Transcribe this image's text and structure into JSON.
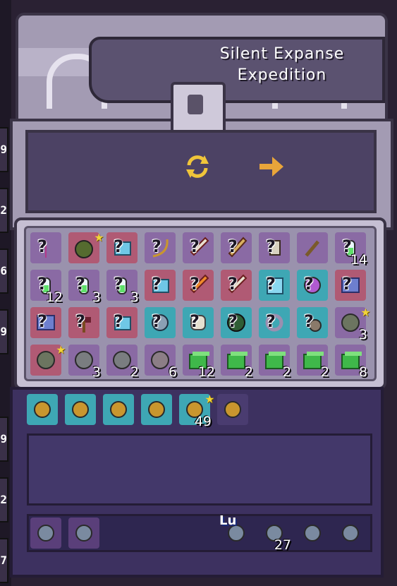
{
  "window_title": "Silent Expanse Expedition",
  "controls": {
    "refresh_icon": "refresh-icon",
    "arrow_icon": "right-arrow-icon",
    "accent": "#e9a53a"
  },
  "edge_numbers": [
    "9",
    "2",
    "6",
    "9",
    "9",
    "2",
    "7"
  ],
  "inventory": {
    "rows": [
      [
        {
          "item": "trident",
          "bg": "#8a6aa4",
          "count": "",
          "star": false,
          "unknown": true
        },
        {
          "item": "moss-bundle",
          "bg": "#b05a74",
          "count": "",
          "star": true,
          "unknown": false
        },
        {
          "item": "ice-rune",
          "bg": "#b05a74",
          "count": "",
          "star": false,
          "unknown": true
        },
        {
          "item": "bow",
          "bg": "#8a6aa4",
          "count": "",
          "star": false,
          "unknown": true
        },
        {
          "item": "blade",
          "bg": "#8a6aa4",
          "count": "",
          "star": false,
          "unknown": true
        },
        {
          "item": "spear",
          "bg": "#8a6aa4",
          "count": "",
          "star": false,
          "unknown": true
        },
        {
          "item": "claw",
          "bg": "#8a6aa4",
          "count": "",
          "star": false,
          "unknown": true
        },
        {
          "item": "staff",
          "bg": "#8a6aa4",
          "count": "",
          "star": false,
          "unknown": false
        },
        {
          "item": "potion",
          "bg": "#8a6aa4",
          "count": "14",
          "star": false,
          "unknown": true
        }
      ],
      [
        {
          "item": "potion",
          "bg": "#8a6aa4",
          "count": "12",
          "star": false,
          "unknown": true
        },
        {
          "item": "potion",
          "bg": "#8a6aa4",
          "count": "3",
          "star": false,
          "unknown": true
        },
        {
          "item": "potion",
          "bg": "#8a6aa4",
          "count": "3",
          "star": false,
          "unknown": true
        },
        {
          "item": "ice-rune",
          "bg": "#b05a74",
          "count": "",
          "star": false,
          "unknown": true
        },
        {
          "item": "flame-blade",
          "bg": "#b05a74",
          "count": "",
          "star": false,
          "unknown": true
        },
        {
          "item": "blade",
          "bg": "#b05a74",
          "count": "",
          "star": false,
          "unknown": true
        },
        {
          "item": "crystal-armor",
          "bg": "#3ea7b4",
          "count": "",
          "star": false,
          "unknown": true
        },
        {
          "item": "orb-charm",
          "bg": "#3ea7b4",
          "count": "",
          "star": false,
          "unknown": true
        },
        {
          "item": "spellbook",
          "bg": "#b05a74",
          "count": "",
          "star": false,
          "unknown": true
        }
      ],
      [
        {
          "item": "spellbook",
          "bg": "#b05a74",
          "count": "",
          "star": false,
          "unknown": true
        },
        {
          "item": "hammer",
          "bg": "#b05a74",
          "count": "",
          "star": false,
          "unknown": true
        },
        {
          "item": "ice-rune",
          "bg": "#b05a74",
          "count": "",
          "star": false,
          "unknown": true
        },
        {
          "item": "helmet",
          "bg": "#3ea7b4",
          "count": "",
          "star": false,
          "unknown": true
        },
        {
          "item": "skull",
          "bg": "#3ea7b4",
          "count": "",
          "star": false,
          "unknown": true
        },
        {
          "item": "dark-orb",
          "bg": "#3ea7b4",
          "count": "",
          "star": false,
          "unknown": true
        },
        {
          "item": "ring",
          "bg": "#3ea7b4",
          "count": "",
          "star": false,
          "unknown": true
        },
        {
          "item": "flail",
          "bg": "#3ea7b4",
          "count": "",
          "star": false,
          "unknown": true
        },
        {
          "item": "stone-3",
          "bg": "#8a6aa4",
          "count": "3",
          "star": true,
          "unknown": false
        }
      ],
      [
        {
          "item": "stone-3",
          "bg": "#b05a74",
          "count": "",
          "star": true,
          "unknown": false
        },
        {
          "item": "wind-stone",
          "bg": "#8a6aa4",
          "count": "3",
          "star": false,
          "unknown": false
        },
        {
          "item": "wind-stone",
          "bg": "#8a6aa4",
          "count": "2",
          "star": false,
          "unknown": false
        },
        {
          "item": "rune-stone",
          "bg": "#8a6aa4",
          "count": "6",
          "star": false,
          "unknown": false
        },
        {
          "item": "green-block",
          "bg": "#8a6aa4",
          "count": "12",
          "star": false,
          "unknown": false
        },
        {
          "item": "green-block",
          "bg": "#8a6aa4",
          "count": "2",
          "star": false,
          "unknown": false
        },
        {
          "item": "green-block",
          "bg": "#8a6aa4",
          "count": "2",
          "star": false,
          "unknown": false
        },
        {
          "item": "green-block",
          "bg": "#8a6aa4",
          "count": "2",
          "star": false,
          "unknown": false
        },
        {
          "item": "green-block",
          "bg": "#8a6aa4",
          "count": "8",
          "star": false,
          "unknown": false
        }
      ]
    ]
  },
  "accessories": [
    {
      "item": "gem-ring",
      "count": "",
      "star": false
    },
    {
      "item": "gold-ring",
      "count": "",
      "star": false
    },
    {
      "item": "backpack",
      "count": "",
      "star": false
    },
    {
      "item": "pendant",
      "count": "",
      "star": false
    },
    {
      "item": "bag-49",
      "count": "49",
      "star": true
    },
    {
      "item": "seed-bag",
      "count": "",
      "star": false
    }
  ],
  "hotbar": [
    {
      "item": "cane",
      "count": ""
    },
    {
      "item": "pickaxe",
      "count": ""
    },
    {
      "item": "luck-figure",
      "count": "",
      "label": "Lu"
    },
    {
      "item": "red-potion",
      "count": "27"
    },
    {
      "item": "compass",
      "count": ""
    },
    {
      "item": "green-book",
      "count": ""
    }
  ]
}
